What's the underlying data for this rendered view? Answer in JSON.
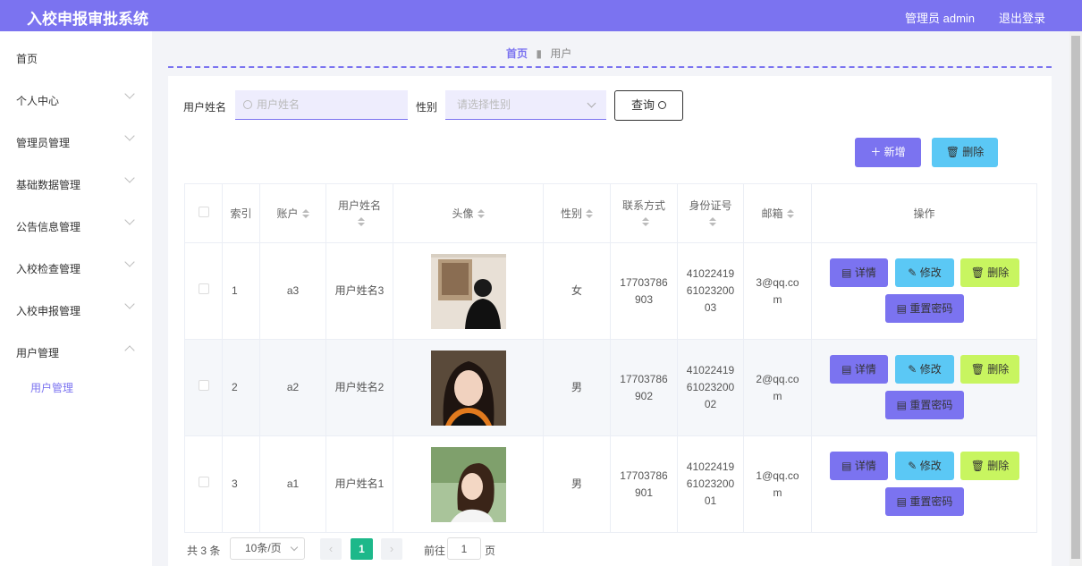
{
  "app": {
    "title": "入校申报审批系统",
    "admin": "管理员 admin",
    "logout": "退出登录"
  },
  "sidebar": {
    "items": [
      {
        "label": "首页",
        "chevron": false
      },
      {
        "label": "个人中心",
        "chevron": true
      },
      {
        "label": "管理员管理",
        "chevron": true
      },
      {
        "label": "基础数据管理",
        "chevron": true
      },
      {
        "label": "公告信息管理",
        "chevron": true
      },
      {
        "label": "入校检查管理",
        "chevron": true
      },
      {
        "label": "入校申报管理",
        "chevron": true
      },
      {
        "label": "用户管理",
        "chevron": true,
        "expanded": true
      }
    ],
    "subitem": "用户管理"
  },
  "breadcrumb": {
    "home": "首页",
    "current": "用户"
  },
  "search": {
    "name_label": "用户姓名",
    "name_placeholder": "用户姓名",
    "sex_label": "性别",
    "sex_placeholder": "请选择性别",
    "query_label": "查询"
  },
  "actions": {
    "add": "新增",
    "delete": "删除"
  },
  "table": {
    "headers": {
      "index": "索引",
      "account": "账户",
      "name": "用户姓名",
      "avatar": "头像",
      "sex": "性别",
      "phone": "联系方式",
      "idcard": "身份证号",
      "email": "邮箱",
      "ops": "操作"
    },
    "rows": [
      {
        "index": "1",
        "account": "a3",
        "name": "用户姓名3",
        "sex": "女",
        "phone": "17703786903",
        "idcard": "410224196102320003",
        "email": "3@qq.com"
      },
      {
        "index": "2",
        "account": "a2",
        "name": "用户姓名2",
        "sex": "男",
        "phone": "17703786902",
        "idcard": "410224196102320002",
        "email": "2@qq.com"
      },
      {
        "index": "3",
        "account": "a1",
        "name": "用户姓名1",
        "sex": "男",
        "phone": "17703786901",
        "idcard": "410224196102320001",
        "email": "1@qq.com"
      }
    ],
    "ops": {
      "detail": "详情",
      "edit": "修改",
      "delete": "删除",
      "reset": "重置密码"
    }
  },
  "pager": {
    "total": "共 3 条",
    "size": "10条/页",
    "current": "1",
    "goto": "前往",
    "goto_value": "1",
    "page_suffix": "页"
  },
  "colors": {
    "primary": "#7b73f0",
    "info": "#5bc8f5",
    "lime": "#c8f560",
    "success": "#1db88a"
  }
}
